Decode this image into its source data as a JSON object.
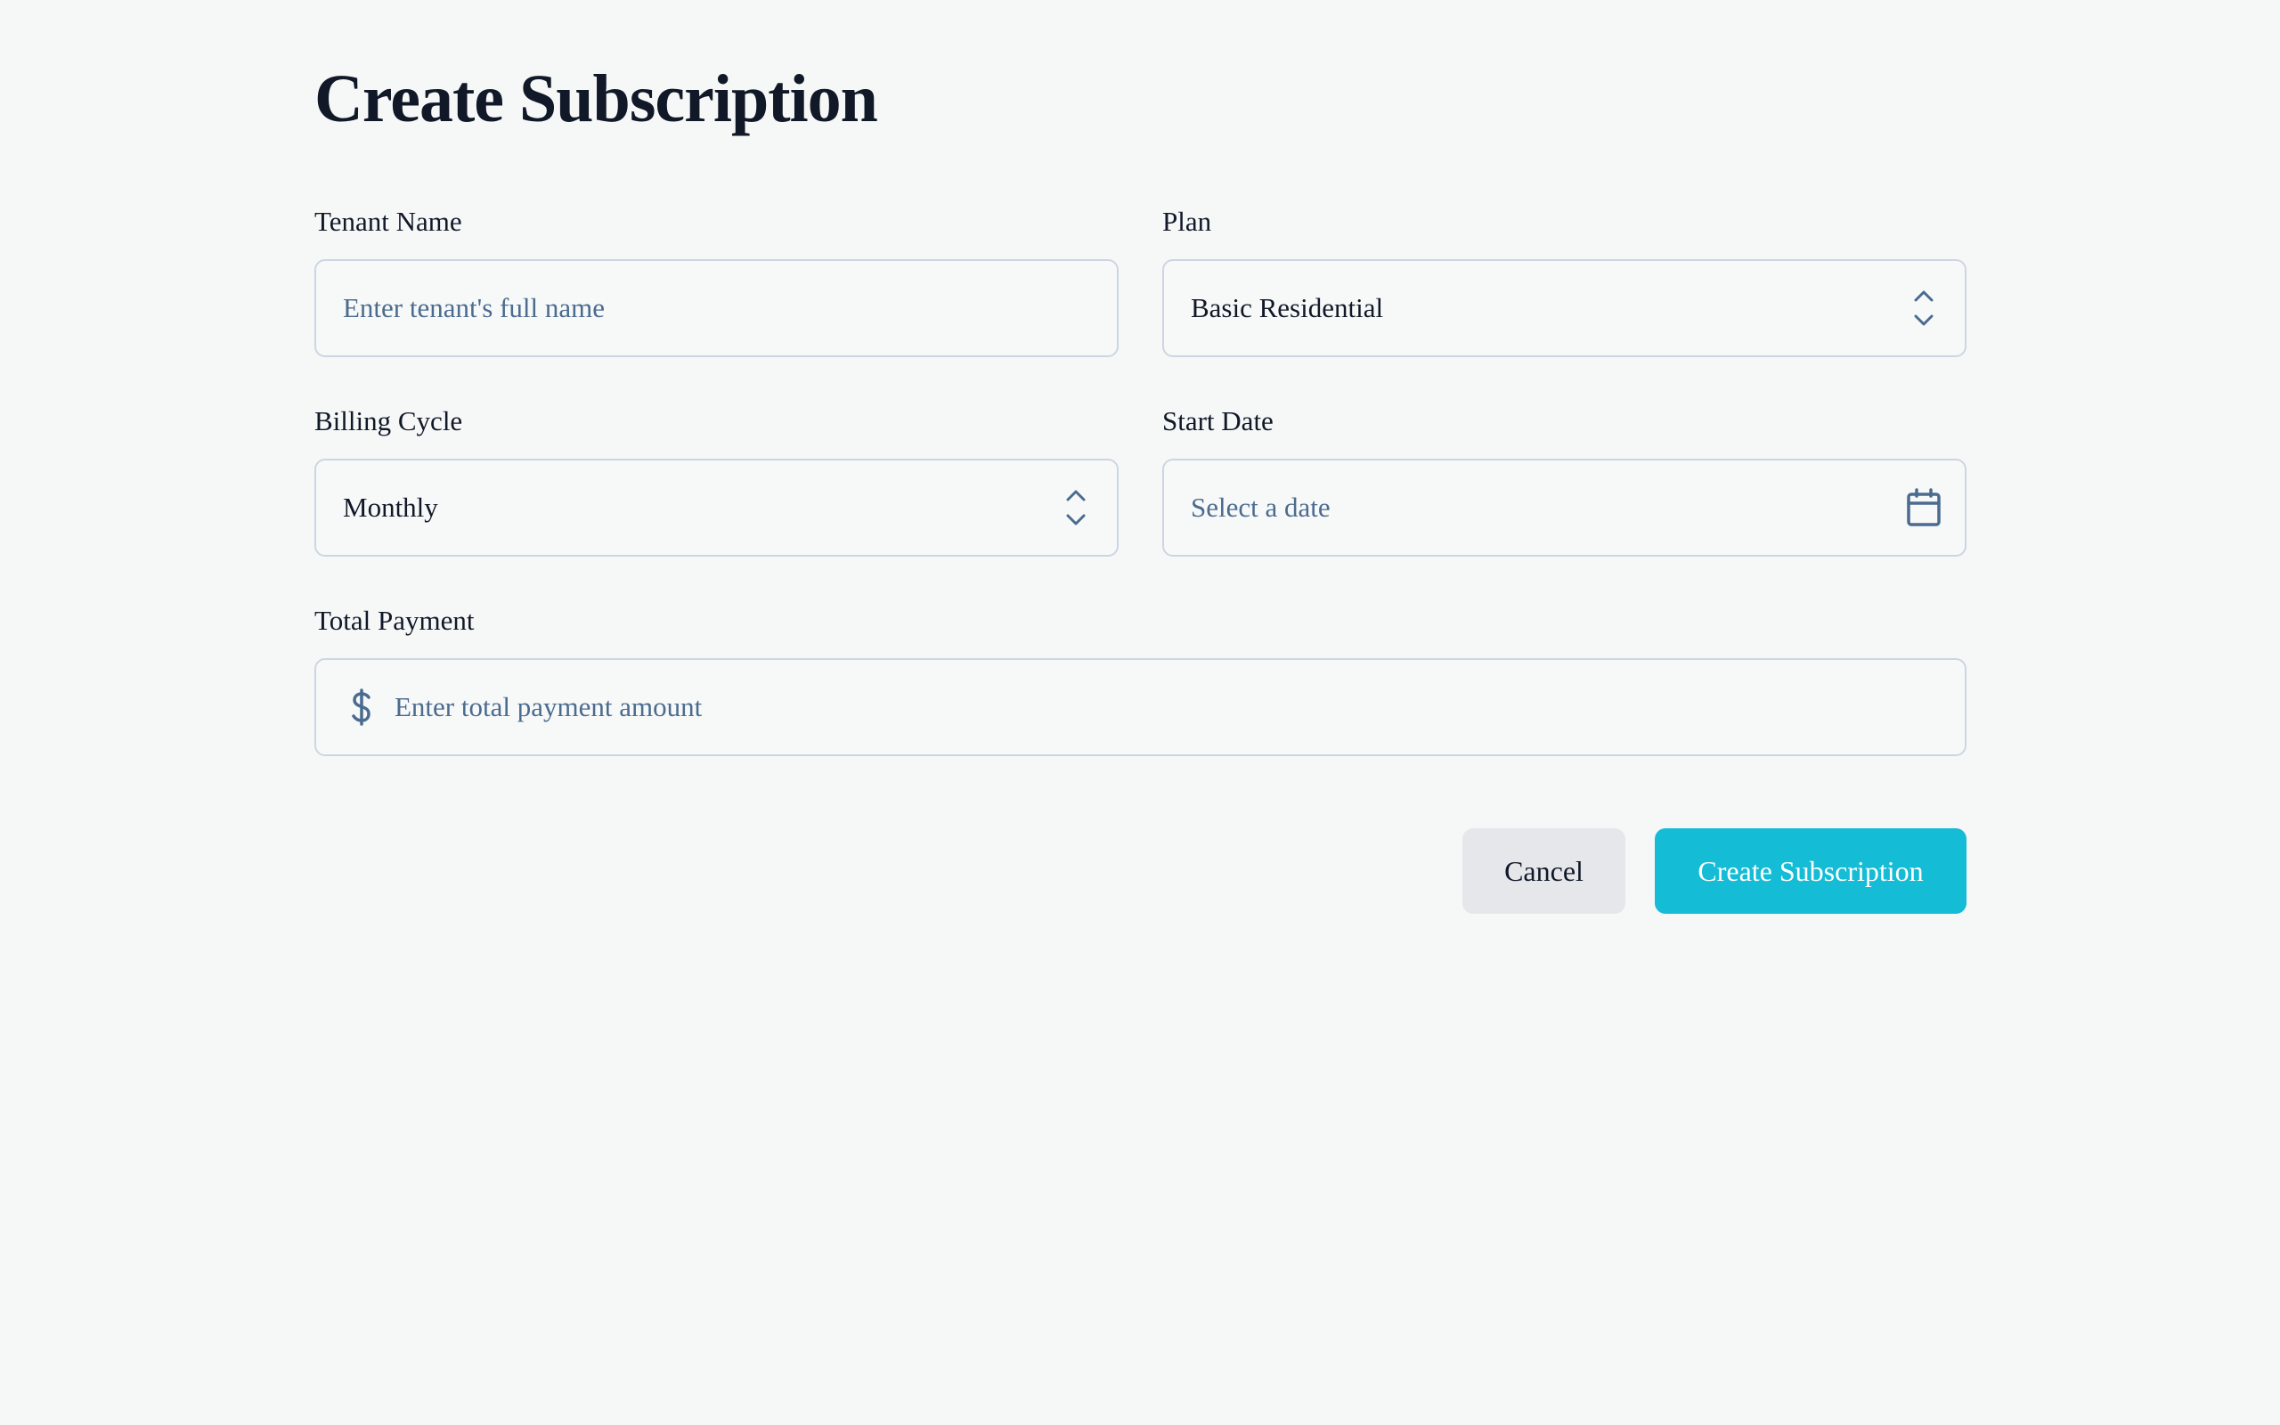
{
  "page": {
    "title": "Create Subscription"
  },
  "form": {
    "tenant_name": {
      "label": "Tenant Name",
      "value": "",
      "placeholder": "Enter tenant's full name"
    },
    "plan": {
      "label": "Plan",
      "value": "Basic Residential",
      "icon": "chevron-up-down-icon"
    },
    "billing_cycle": {
      "label": "Billing Cycle",
      "value": "Monthly",
      "icon": "chevron-up-down-icon"
    },
    "start_date": {
      "label": "Start Date",
      "value": "",
      "placeholder": "Select a date",
      "icon": "calendar-icon"
    },
    "total_payment": {
      "label": "Total Payment",
      "value": "",
      "placeholder": "Enter total payment amount",
      "icon": "dollar-icon"
    }
  },
  "actions": {
    "cancel_label": "Cancel",
    "submit_label": "Create Subscription"
  },
  "colors": {
    "background": "#f6f8f8",
    "accent": "#15bcd6",
    "secondary_button": "#e5e7eb",
    "placeholder": "#4b6b8f",
    "border": "#cdd5e3"
  }
}
